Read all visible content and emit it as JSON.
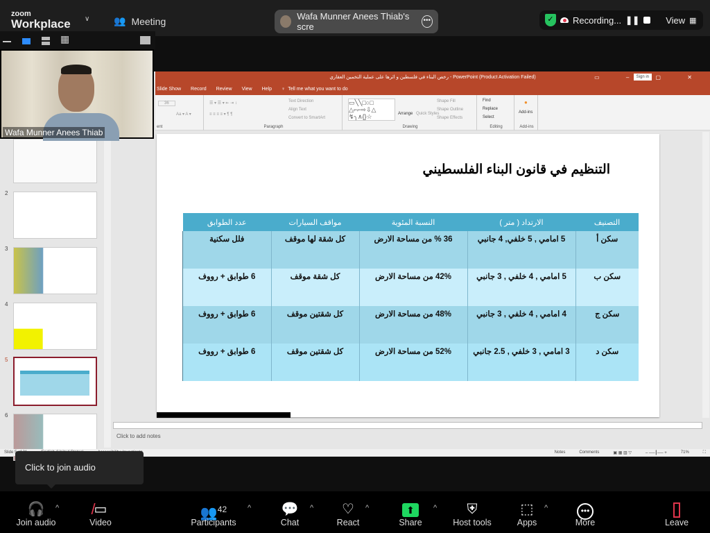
{
  "zoom": {
    "brand_small": "zoom",
    "brand_big": "Workplace",
    "meeting_label": "Meeting",
    "share_pill_label": "Wafa Munner Anees Thiab's scre",
    "recording_label": "Recording...",
    "view_label": "View",
    "video_name": "Wafa Munner Anees Thiab",
    "tooltip": "Click to join audio",
    "toolbar": [
      {
        "id": "join-audio",
        "label": "Join audio",
        "icon": "headphones-icon",
        "glyph": "🎧"
      },
      {
        "id": "video",
        "label": "Video",
        "icon": "video-off-icon",
        "glyph": "📷"
      },
      {
        "id": "participants",
        "label": "Participants",
        "icon": "participants-icon",
        "glyph": "👥",
        "count": "42"
      },
      {
        "id": "chat",
        "label": "Chat",
        "icon": "chat-icon",
        "glyph": "💬"
      },
      {
        "id": "react",
        "label": "React",
        "icon": "heart-icon",
        "glyph": "♡"
      },
      {
        "id": "share",
        "label": "Share",
        "icon": "share-icon",
        "glyph": "⬆"
      },
      {
        "id": "host-tools",
        "label": "Host tools",
        "icon": "shield-icon",
        "glyph": "⛨"
      },
      {
        "id": "apps",
        "label": "Apps",
        "icon": "apps-icon",
        "glyph": "⊞"
      },
      {
        "id": "more",
        "label": "More",
        "icon": "more-icon",
        "glyph": "⋯"
      },
      {
        "id": "leave",
        "label": "Leave",
        "icon": "leave-icon",
        "glyph": "🚪"
      }
    ],
    "colors": {
      "share_green": "#1ed760",
      "record_red": "#e0354c",
      "leave_red": "#e0354c",
      "shield_green": "#26c35f"
    }
  },
  "powerpoint": {
    "title": "رخص البناء في فلسطين و اثرها على عملية التخمين العقاري - PowerPoint (Product Activation Failed)",
    "sign_in": "Sign in",
    "menu": [
      "Slide Show",
      "Record",
      "Review",
      "View",
      "Help",
      "Tell me what you want to do"
    ],
    "ribbon": {
      "groups": [
        "Paragraph",
        "Drawing",
        "Editing",
        "Add-ins"
      ],
      "paragraph_items": [
        "Text Direction",
        "Align Text",
        "Convert to SmartArt"
      ],
      "drawing_items": [
        "Arrange",
        "Quick Styles",
        "Shape Fill",
        "Shape Outline",
        "Shape Effects"
      ],
      "editing_items": [
        "Find",
        "Replace",
        "Select"
      ],
      "addins_item": "Add-ins",
      "font_size": "36",
      "font_group_partial": "ent"
    },
    "thumbnails": [
      {
        "num": "2"
      },
      {
        "num": "3"
      },
      {
        "num": "4"
      },
      {
        "num": "5",
        "active": true
      },
      {
        "num": "6"
      }
    ],
    "notes_placeholder": "Click to add notes",
    "status": {
      "slide": "Slide 5 of 21",
      "language": "English (United States)",
      "accessibility": "Accessibility: Investigate",
      "notes": "Notes",
      "comments": "Comments",
      "zoom": "71%"
    },
    "colors": {
      "accent": "#b7472a",
      "table_header": "#4aaccc",
      "row_dark": "#9fd7e9",
      "row_light": "#c9eefb"
    }
  },
  "slide": {
    "title": "التنظيم في قانون البناء الفلسطيني",
    "table": {
      "headers": [
        "التصنيف",
        "الارتداد ( متر )",
        "النسبة المئوية",
        "مواقف السيارات",
        "عدد الطوابق"
      ],
      "rows": [
        [
          "سكن أ",
          "5 امامي , 5 خلفي, 4 جانبي",
          "36 % من مساحة الارض",
          "كل شقة لها موقف",
          "فلل سكنية"
        ],
        [
          "سكن ب",
          "5 امامي , 4 خلفي , 3 جانبي",
          "42% من مساحة الارض",
          "كل شقة موقف",
          "6 طوابق + رووف"
        ],
        [
          "سكن ج",
          "4 امامي , 4 خلفي , 3 جانبي",
          "48% من مساحة الارض",
          "كل شقتين موقف",
          "6 طوابق + رووف"
        ],
        [
          "سكن د",
          "3 امامي , 3 خلفي , 2.5 جانبي",
          "52% من مساحة الارض",
          "كل شقتين موقف",
          "6 طوابق + رووف"
        ]
      ]
    }
  }
}
